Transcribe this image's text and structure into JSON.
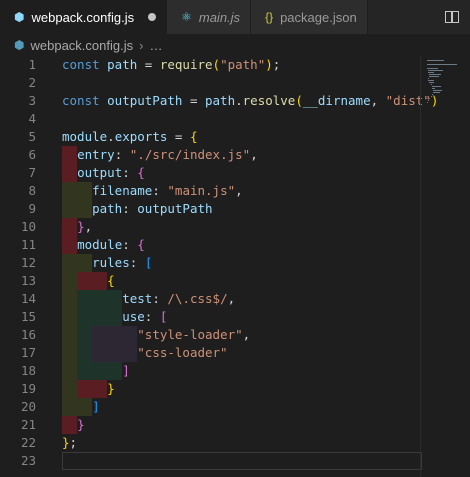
{
  "tabs": [
    {
      "label": "webpack.config.js",
      "icon": "webpack-icon",
      "active": true,
      "dirty": true
    },
    {
      "label": "main.js",
      "icon": "react-icon",
      "active": false,
      "italic": true
    },
    {
      "label": "package.json",
      "icon": "json-icon",
      "active": false
    }
  ],
  "breadcrumb": {
    "file": "webpack.config.js",
    "more": "…",
    "sep": "›"
  },
  "lines": [
    {
      "n": "1",
      "tokens": [
        [
          "k",
          "const "
        ],
        [
          "v",
          "path"
        ],
        [
          "p",
          " = "
        ],
        [
          "f",
          "require"
        ],
        [
          "b1",
          "("
        ],
        [
          "s",
          "\"path\""
        ],
        [
          "b1",
          ")"
        ],
        [
          "p",
          ";"
        ]
      ]
    },
    {
      "n": "2",
      "tokens": []
    },
    {
      "n": "3",
      "tokens": [
        [
          "k",
          "const "
        ],
        [
          "v",
          "outputPath"
        ],
        [
          "p",
          " = "
        ],
        [
          "v",
          "path"
        ],
        [
          "p",
          "."
        ],
        [
          "f",
          "resolve"
        ],
        [
          "b1",
          "("
        ],
        [
          "v",
          "__dirname"
        ],
        [
          "p",
          ", "
        ],
        [
          "s",
          "\"dist\""
        ],
        [
          "b1",
          ")"
        ]
      ]
    },
    {
      "n": "4",
      "tokens": []
    },
    {
      "n": "5",
      "tokens": [
        [
          "v",
          "module"
        ],
        [
          "p",
          "."
        ],
        [
          "v",
          "exports"
        ],
        [
          "p",
          " = "
        ],
        [
          "b1",
          "{"
        ]
      ]
    },
    {
      "n": "6",
      "tokens": [
        [
          "p",
          "  "
        ],
        [
          "v",
          "entry"
        ],
        [
          "p",
          ": "
        ],
        [
          "s",
          "\"./src/index.js\""
        ],
        [
          "p",
          ","
        ]
      ]
    },
    {
      "n": "7",
      "tokens": [
        [
          "p",
          "  "
        ],
        [
          "v",
          "output"
        ],
        [
          "p",
          ": "
        ],
        [
          "b2",
          "{"
        ]
      ]
    },
    {
      "n": "8",
      "tokens": [
        [
          "p",
          "    "
        ],
        [
          "v",
          "filename"
        ],
        [
          "p",
          ": "
        ],
        [
          "s",
          "\"main.js\""
        ],
        [
          "p",
          ","
        ]
      ]
    },
    {
      "n": "9",
      "tokens": [
        [
          "p",
          "    "
        ],
        [
          "v",
          "path"
        ],
        [
          "p",
          ": "
        ],
        [
          "v",
          "outputPath"
        ]
      ]
    },
    {
      "n": "10",
      "tokens": [
        [
          "p",
          "  "
        ],
        [
          "b2",
          "}"
        ],
        [
          "p",
          ","
        ]
      ]
    },
    {
      "n": "11",
      "tokens": [
        [
          "p",
          "  "
        ],
        [
          "v",
          "module"
        ],
        [
          "p",
          ": "
        ],
        [
          "b2",
          "{"
        ]
      ]
    },
    {
      "n": "12",
      "tokens": [
        [
          "p",
          "    "
        ],
        [
          "v",
          "rules"
        ],
        [
          "p",
          ": "
        ],
        [
          "b3",
          "["
        ]
      ]
    },
    {
      "n": "13",
      "tokens": [
        [
          "p",
          "      "
        ],
        [
          "b1",
          "{"
        ]
      ]
    },
    {
      "n": "14",
      "tokens": [
        [
          "p",
          "        "
        ],
        [
          "v",
          "test"
        ],
        [
          "p",
          ": "
        ],
        [
          "s",
          "/\\.css$/"
        ],
        [
          "p",
          ","
        ]
      ]
    },
    {
      "n": "15",
      "tokens": [
        [
          "p",
          "        "
        ],
        [
          "v",
          "use"
        ],
        [
          "p",
          ": "
        ],
        [
          "b2",
          "["
        ]
      ]
    },
    {
      "n": "16",
      "tokens": [
        [
          "p",
          "          "
        ],
        [
          "s",
          "\"style-loader\""
        ],
        [
          "p",
          ","
        ]
      ]
    },
    {
      "n": "17",
      "tokens": [
        [
          "p",
          "          "
        ],
        [
          "s",
          "\"css-loader\""
        ]
      ]
    },
    {
      "n": "18",
      "tokens": [
        [
          "p",
          "        "
        ],
        [
          "b2",
          "]"
        ]
      ]
    },
    {
      "n": "19",
      "tokens": [
        [
          "p",
          "      "
        ],
        [
          "b1",
          "}"
        ]
      ]
    },
    {
      "n": "20",
      "tokens": [
        [
          "p",
          "    "
        ],
        [
          "b3",
          "]"
        ]
      ]
    },
    {
      "n": "21",
      "tokens": [
        [
          "p",
          "  "
        ],
        [
          "b2",
          "}"
        ]
      ]
    },
    {
      "n": "22",
      "tokens": [
        [
          "b1",
          "}"
        ],
        [
          "p",
          ";"
        ]
      ]
    },
    {
      "n": "23",
      "tokens": []
    }
  ],
  "colors": {
    "indent_error": "#5a1d22",
    "indent_1": "#33361f",
    "indent_2": "#1e3329",
    "indent_3": "#2d2633",
    "keyword": "#569cd6",
    "string": "#ce9178"
  }
}
